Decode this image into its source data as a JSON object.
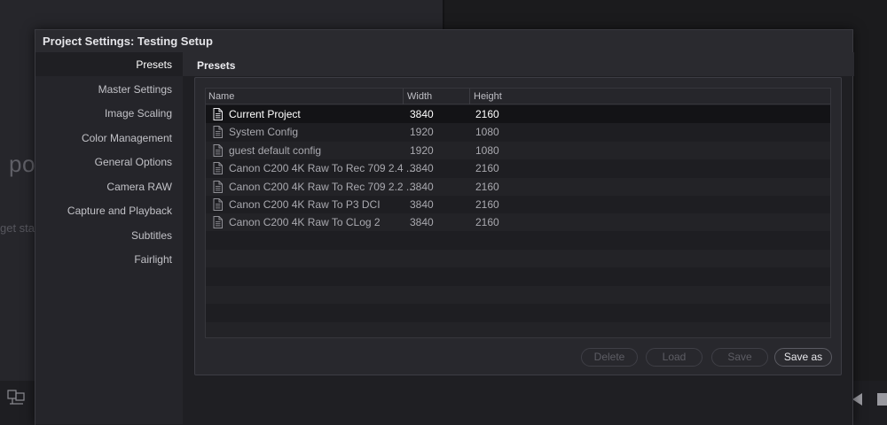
{
  "background": {
    "fragment_po": "po",
    "fragment_get": "get sta"
  },
  "dialog": {
    "title": "Project Settings:  Testing Setup",
    "content_header": "Presets"
  },
  "sidebar": {
    "items": [
      {
        "label": "Presets",
        "active": true
      },
      {
        "label": "Master Settings"
      },
      {
        "label": "Image Scaling"
      },
      {
        "label": "Color Management"
      },
      {
        "label": "General Options"
      },
      {
        "label": "Camera RAW"
      },
      {
        "label": "Capture and Playback"
      },
      {
        "label": "Subtitles"
      },
      {
        "label": "Fairlight"
      }
    ]
  },
  "table": {
    "columns": [
      "Name",
      "Width",
      "Height"
    ],
    "rows": [
      {
        "name": "Current Project",
        "width": "3840",
        "height": "2160",
        "selected": true
      },
      {
        "name": "System Config",
        "width": "1920",
        "height": "1080"
      },
      {
        "name": "guest default config",
        "width": "1920",
        "height": "1080"
      },
      {
        "name": "Canon C200 4K Raw To Rec 709 2.4 ...",
        "width": "3840",
        "height": "2160"
      },
      {
        "name": "Canon C200 4K Raw To Rec 709 2.2 ...",
        "width": "3840",
        "height": "2160"
      },
      {
        "name": "Canon C200 4K Raw To P3 DCI",
        "width": "3840",
        "height": "2160"
      },
      {
        "name": "Canon C200 4K Raw To CLog 2",
        "width": "3840",
        "height": "2160"
      }
    ]
  },
  "buttons": {
    "delete": "Delete",
    "load": "Load",
    "save": "Save",
    "save_as": "Save as"
  },
  "icons": {
    "file": "document-icon",
    "left_tool": "layout-icon",
    "play": "play-reverse-icon",
    "stop": "stop-icon"
  },
  "colors": {
    "dialog_bg": "#1f1f23",
    "selected_row": "#131316",
    "text_primary": "#ffffff"
  }
}
